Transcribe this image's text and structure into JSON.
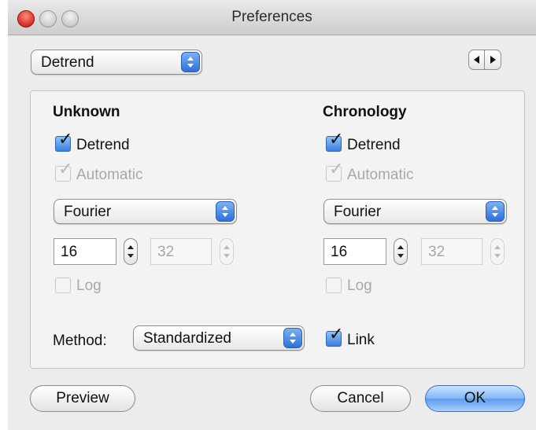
{
  "window": {
    "title": "Preferences"
  },
  "top": {
    "category_select": "Detrend"
  },
  "unknown": {
    "heading": "Unknown",
    "detrend_label": "Detrend",
    "detrend_checked": true,
    "automatic_label": "Automatic",
    "automatic_checked": true,
    "method_select": "Fourier",
    "value1": "16",
    "value2": "32",
    "log_label": "Log"
  },
  "chronology": {
    "heading": "Chronology",
    "detrend_label": "Detrend",
    "detrend_checked": true,
    "automatic_label": "Automatic",
    "automatic_checked": true,
    "method_select": "Fourier",
    "value1": "16",
    "value2": "32",
    "log_label": "Log"
  },
  "method": {
    "label": "Method:",
    "select": "Standardized",
    "link_label": "Link",
    "link_checked": true
  },
  "buttons": {
    "preview": "Preview",
    "cancel": "Cancel",
    "ok": "OK"
  },
  "icons": {
    "check_mark": "✓",
    "close": "close-icon",
    "minimize": "minimize-icon",
    "zoom": "zoom-icon"
  },
  "colors": {
    "accent": "#3b7fe0",
    "close_button": "#d8342a"
  }
}
